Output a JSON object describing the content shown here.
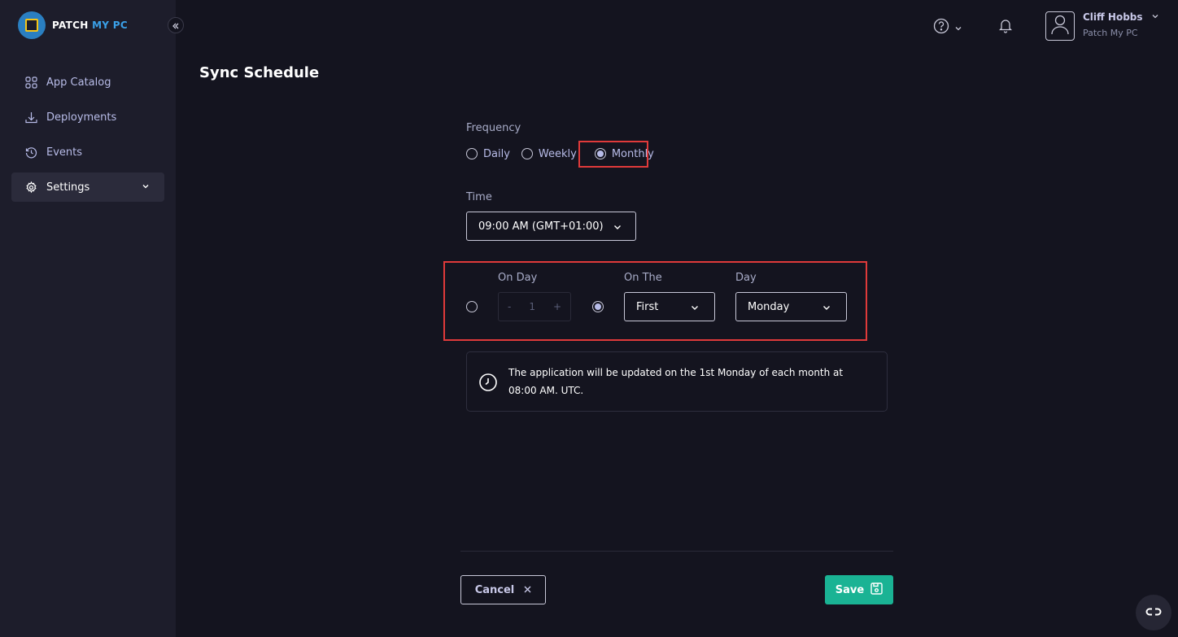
{
  "brand": {
    "name_part1": "PATCH ",
    "name_part2": "MY PC"
  },
  "sidebar": {
    "items": [
      {
        "label": "App Catalog",
        "icon": "grid-icon"
      },
      {
        "label": "Deployments",
        "icon": "download-icon"
      },
      {
        "label": "Events",
        "icon": "history-icon"
      },
      {
        "label": "Settings",
        "icon": "gear-icon",
        "active": true
      }
    ]
  },
  "header": {
    "user_name": "Cliff Hobbs",
    "user_org": "Patch My PC"
  },
  "page": {
    "title": "Sync Schedule"
  },
  "form": {
    "frequency_label": "Frequency",
    "frequency_options": [
      "Daily",
      "Weekly",
      "Monthly"
    ],
    "frequency_selected": "Monthly",
    "time_label": "Time",
    "time_value": "09:00 AM (GMT+01:00)",
    "on_day_label": "On Day",
    "on_day_minus": "-",
    "on_day_value": "1",
    "on_day_plus": "+",
    "on_the_label": "On The",
    "on_the_value": "First",
    "day_label": "Day",
    "day_value": "Monday",
    "selected_mode": "on_the",
    "info_text": "The application will be updated on the 1st Monday of each month at 08:00 AM. UTC."
  },
  "actions": {
    "cancel_label": "Cancel",
    "save_label": "Save"
  },
  "colors": {
    "background": "#14141f",
    "sidebar": "#1d1d2b",
    "accent_save": "#1ab394",
    "highlight": "#e03a3a"
  }
}
